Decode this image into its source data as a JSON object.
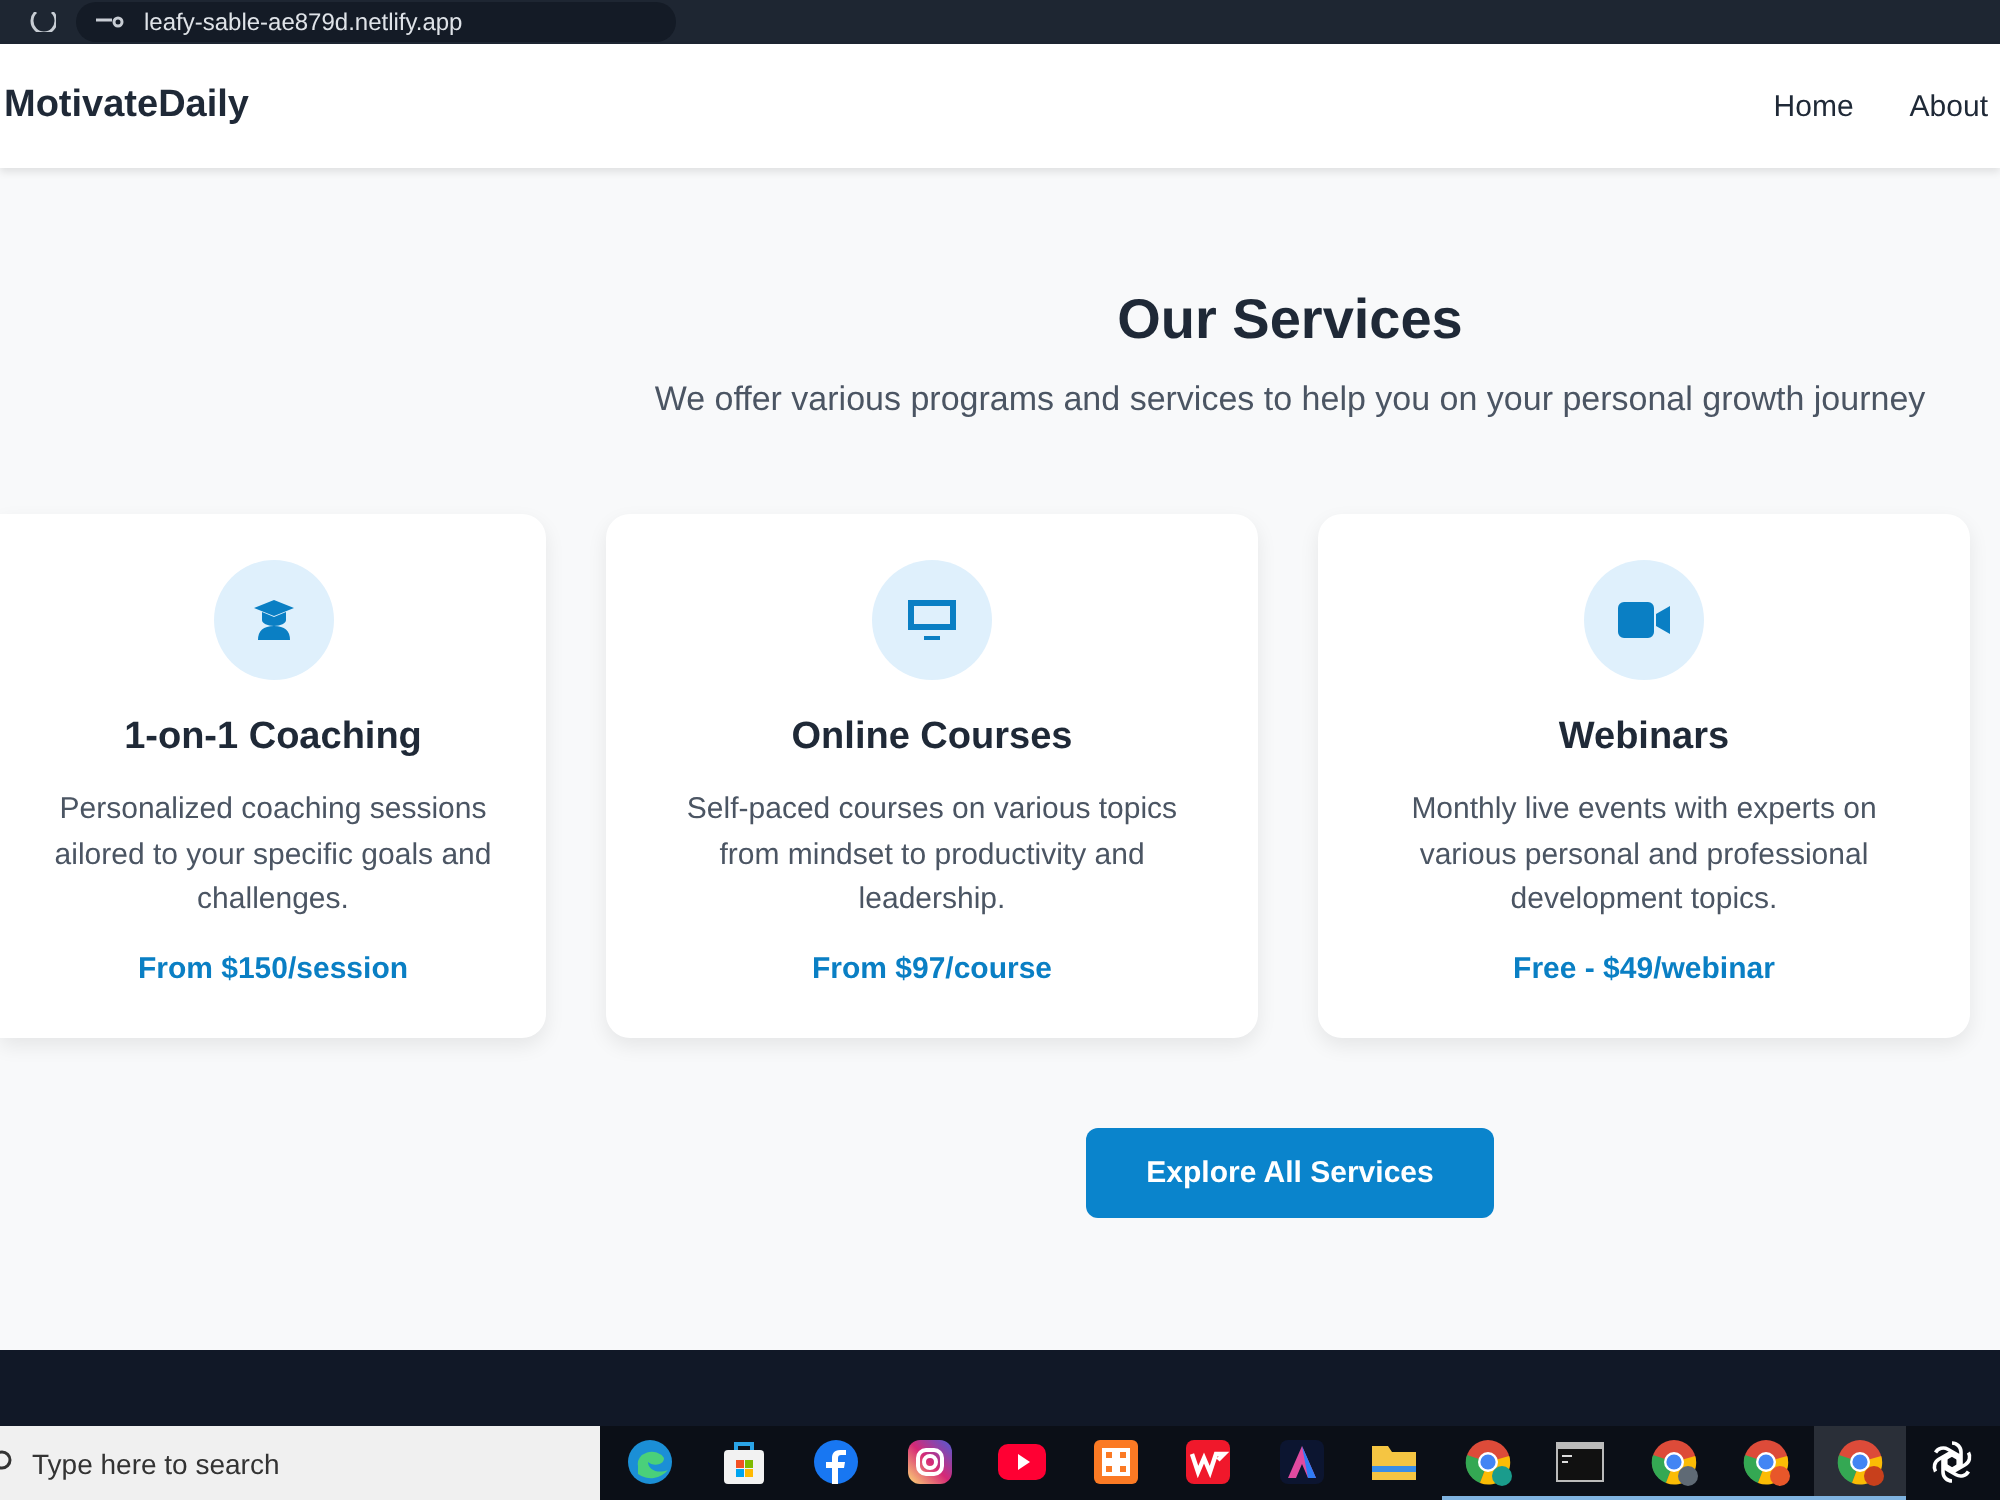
{
  "browser": {
    "url": "leafy-sable-ae879d.netlify.app"
  },
  "nav": {
    "brand": "MotivateDaily",
    "links": [
      "Home",
      "About"
    ]
  },
  "services": {
    "title": "Our Services",
    "subtitle": "We offer various programs and services to help you on your personal growth journey",
    "cards": [
      {
        "kind": "graduate",
        "title": "1-on-1 Coaching",
        "description": "Personalized coaching sessions ailored to your specific goals and challenges.",
        "price": "From $150/session"
      },
      {
        "kind": "monitor",
        "title": "Online Courses",
        "description": "Self-paced courses on various topics from mindset to productivity and leadership.",
        "price": "From $97/course"
      },
      {
        "kind": "video",
        "title": "Webinars",
        "description": "Monthly live events with experts on various personal and professional development topics.",
        "price": "Free - $49/webinar"
      }
    ],
    "button": "Explore All Services"
  },
  "taskbar": {
    "search_placeholder": "Type here to search",
    "apps": [
      {
        "kind": "edge",
        "running": false,
        "active": false
      },
      {
        "kind": "store",
        "running": false,
        "active": false
      },
      {
        "kind": "facebook",
        "running": false,
        "active": false
      },
      {
        "kind": "instagram",
        "running": false,
        "active": false
      },
      {
        "kind": "youtube",
        "running": false,
        "active": false
      },
      {
        "kind": "xampp",
        "running": false,
        "active": false
      },
      {
        "kind": "wps",
        "running": false,
        "active": false
      },
      {
        "kind": "affinity",
        "running": false,
        "active": false
      },
      {
        "kind": "folder",
        "running": false,
        "active": false
      },
      {
        "kind": "chrome",
        "color": "#1a9c8c",
        "running": true,
        "active": false
      },
      {
        "kind": "terminal",
        "running": true,
        "active": false
      },
      {
        "kind": "chrome",
        "color": "#5f6a75",
        "running": true,
        "active": false
      },
      {
        "kind": "chrome",
        "color": "#e8572a",
        "running": true,
        "active": false
      },
      {
        "kind": "chrome",
        "color": "#c8401c",
        "running": true,
        "active": true
      },
      {
        "kind": "openai",
        "running": false,
        "active": false
      }
    ]
  }
}
